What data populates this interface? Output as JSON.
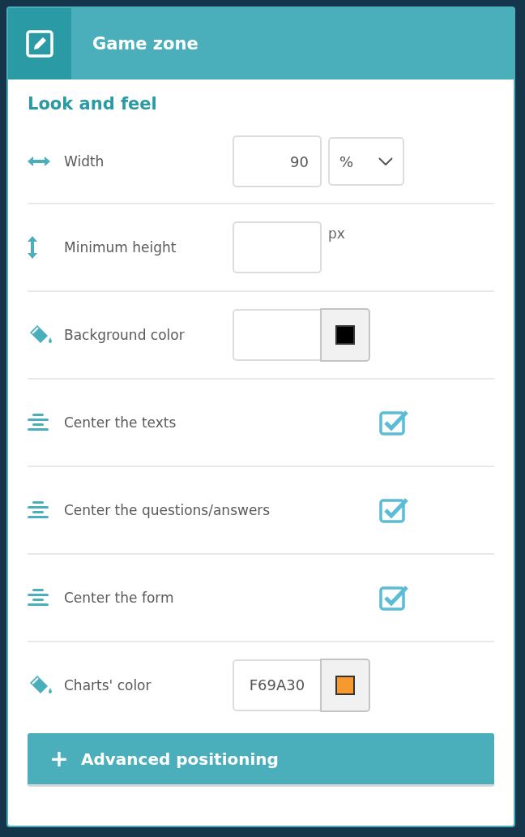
{
  "header": {
    "title": "Game zone"
  },
  "section": {
    "title": "Look and feel"
  },
  "rows": [
    {
      "kind": "size",
      "label": "Width",
      "value": "90",
      "unit": "%"
    },
    {
      "kind": "height",
      "label": "Minimum height",
      "suffix": "px"
    },
    {
      "kind": "color",
      "label": "Background color",
      "color": "#000000"
    },
    {
      "kind": "toggle",
      "label": "Center the texts",
      "checked": true
    },
    {
      "kind": "toggle",
      "label": "Center the questions/answers",
      "checked": true
    },
    {
      "kind": "toggle",
      "label": "Center the form",
      "checked": true
    },
    {
      "kind": "color",
      "label": "Charts' color",
      "value": "F69A30",
      "color": "#f69a30"
    }
  ],
  "advanced": {
    "icon": "+",
    "label": "Advanced positioning"
  }
}
